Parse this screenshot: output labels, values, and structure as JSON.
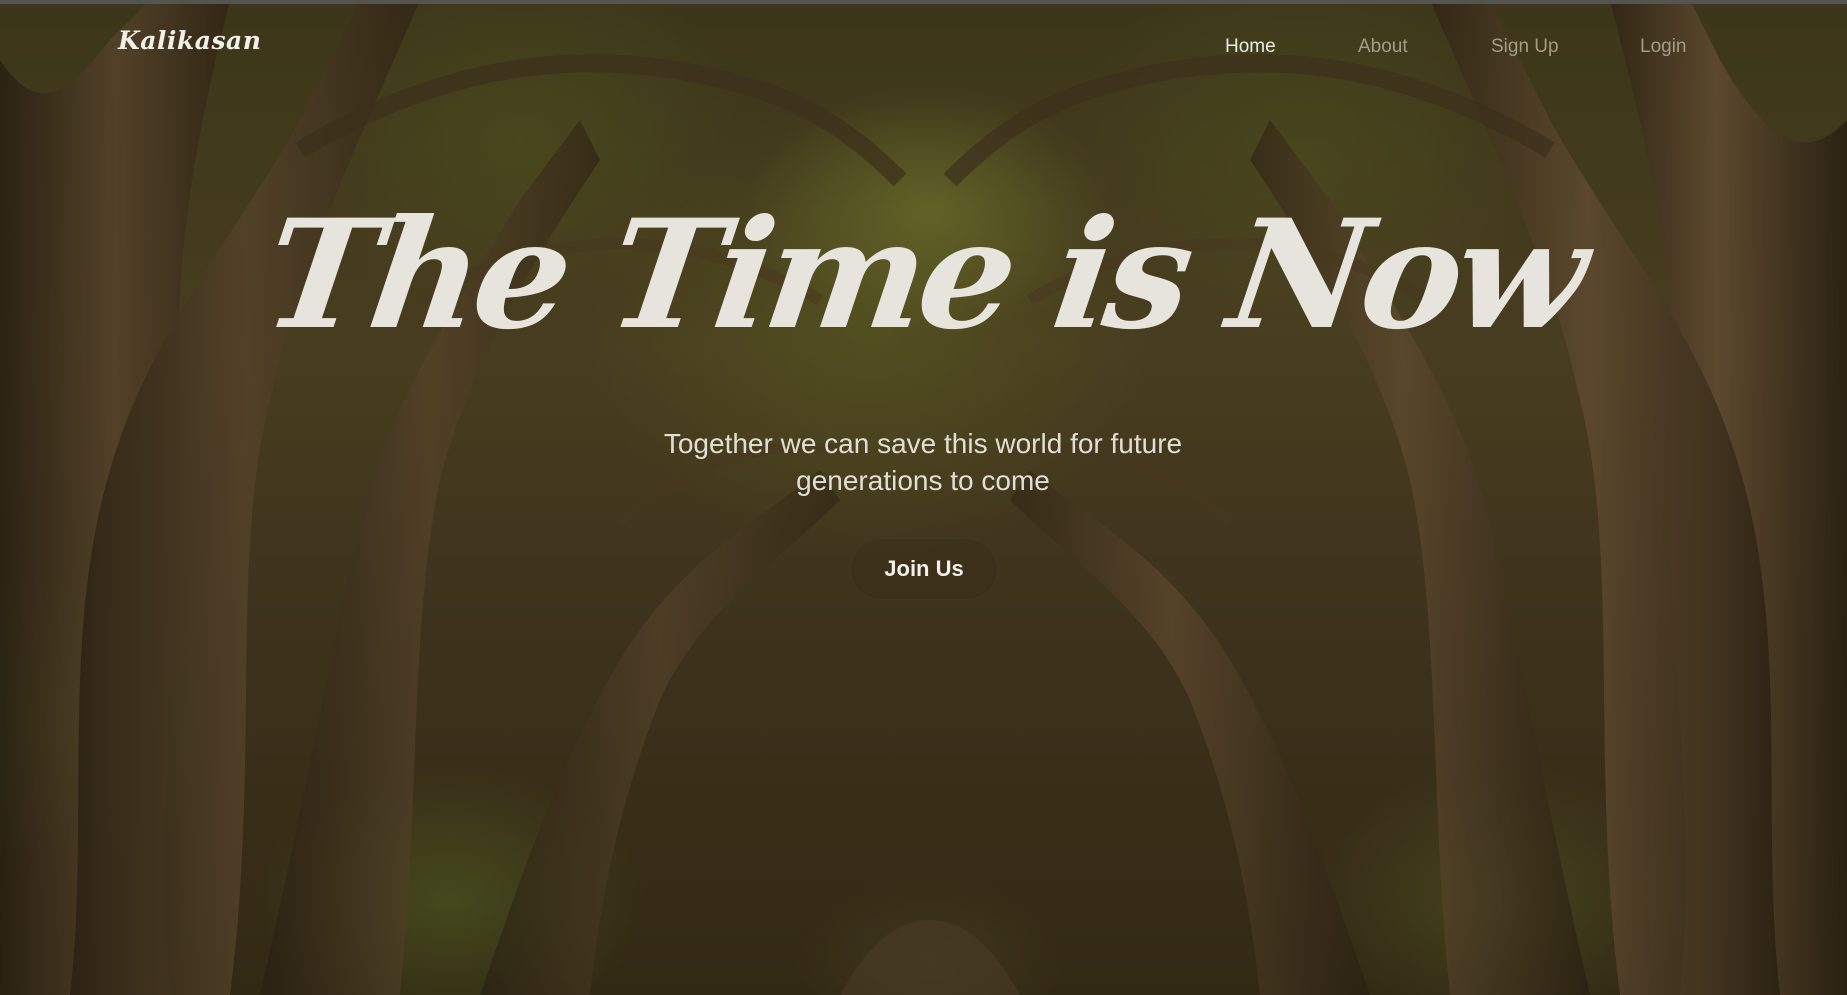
{
  "header": {
    "logo": "Kalikasan",
    "nav": [
      {
        "label": "Home",
        "active": true
      },
      {
        "label": "About",
        "active": false
      },
      {
        "label": "Sign Up",
        "active": false
      },
      {
        "label": "Login",
        "active": false
      }
    ]
  },
  "hero": {
    "title": "The Time is Now",
    "subtitle": "Together we can save this world for future generations to come",
    "cta_label": "Join Us"
  },
  "colors": {
    "text_light": "#e6e4dc",
    "nav_active": "#ecebe6",
    "nav_inactive": "#a59c86",
    "forest_dark": "#3d3219",
    "foliage": "#8a9a38"
  },
  "background": {
    "subject": "forest-tunnel-of-twisted-trees"
  }
}
